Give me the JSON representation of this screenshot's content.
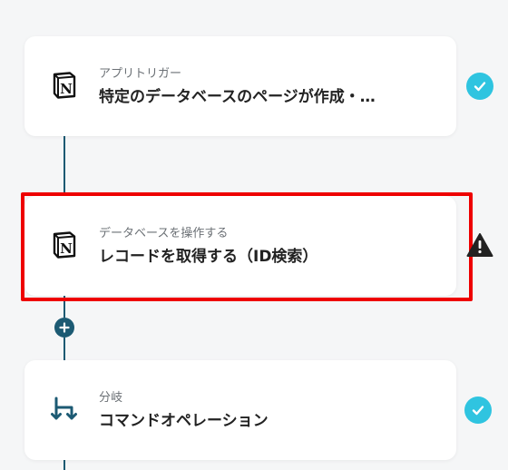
{
  "steps": [
    {
      "sublabel": "アプリトリガー",
      "title": "特定のデータベースのページが作成・…",
      "icon": "notion-icon",
      "status": "complete"
    },
    {
      "sublabel": "データベースを操作する",
      "title": "レコードを取得する（ID検索）",
      "icon": "notion-icon",
      "status": "warning"
    },
    {
      "sublabel": "分岐",
      "title": "コマンドオペレーション",
      "icon": "branch-icon",
      "status": "complete"
    }
  ],
  "colors": {
    "connector": "#1c5a73",
    "check": "#2fc4e0",
    "highlight": "#ee0000",
    "background": "#f5f6f7"
  }
}
